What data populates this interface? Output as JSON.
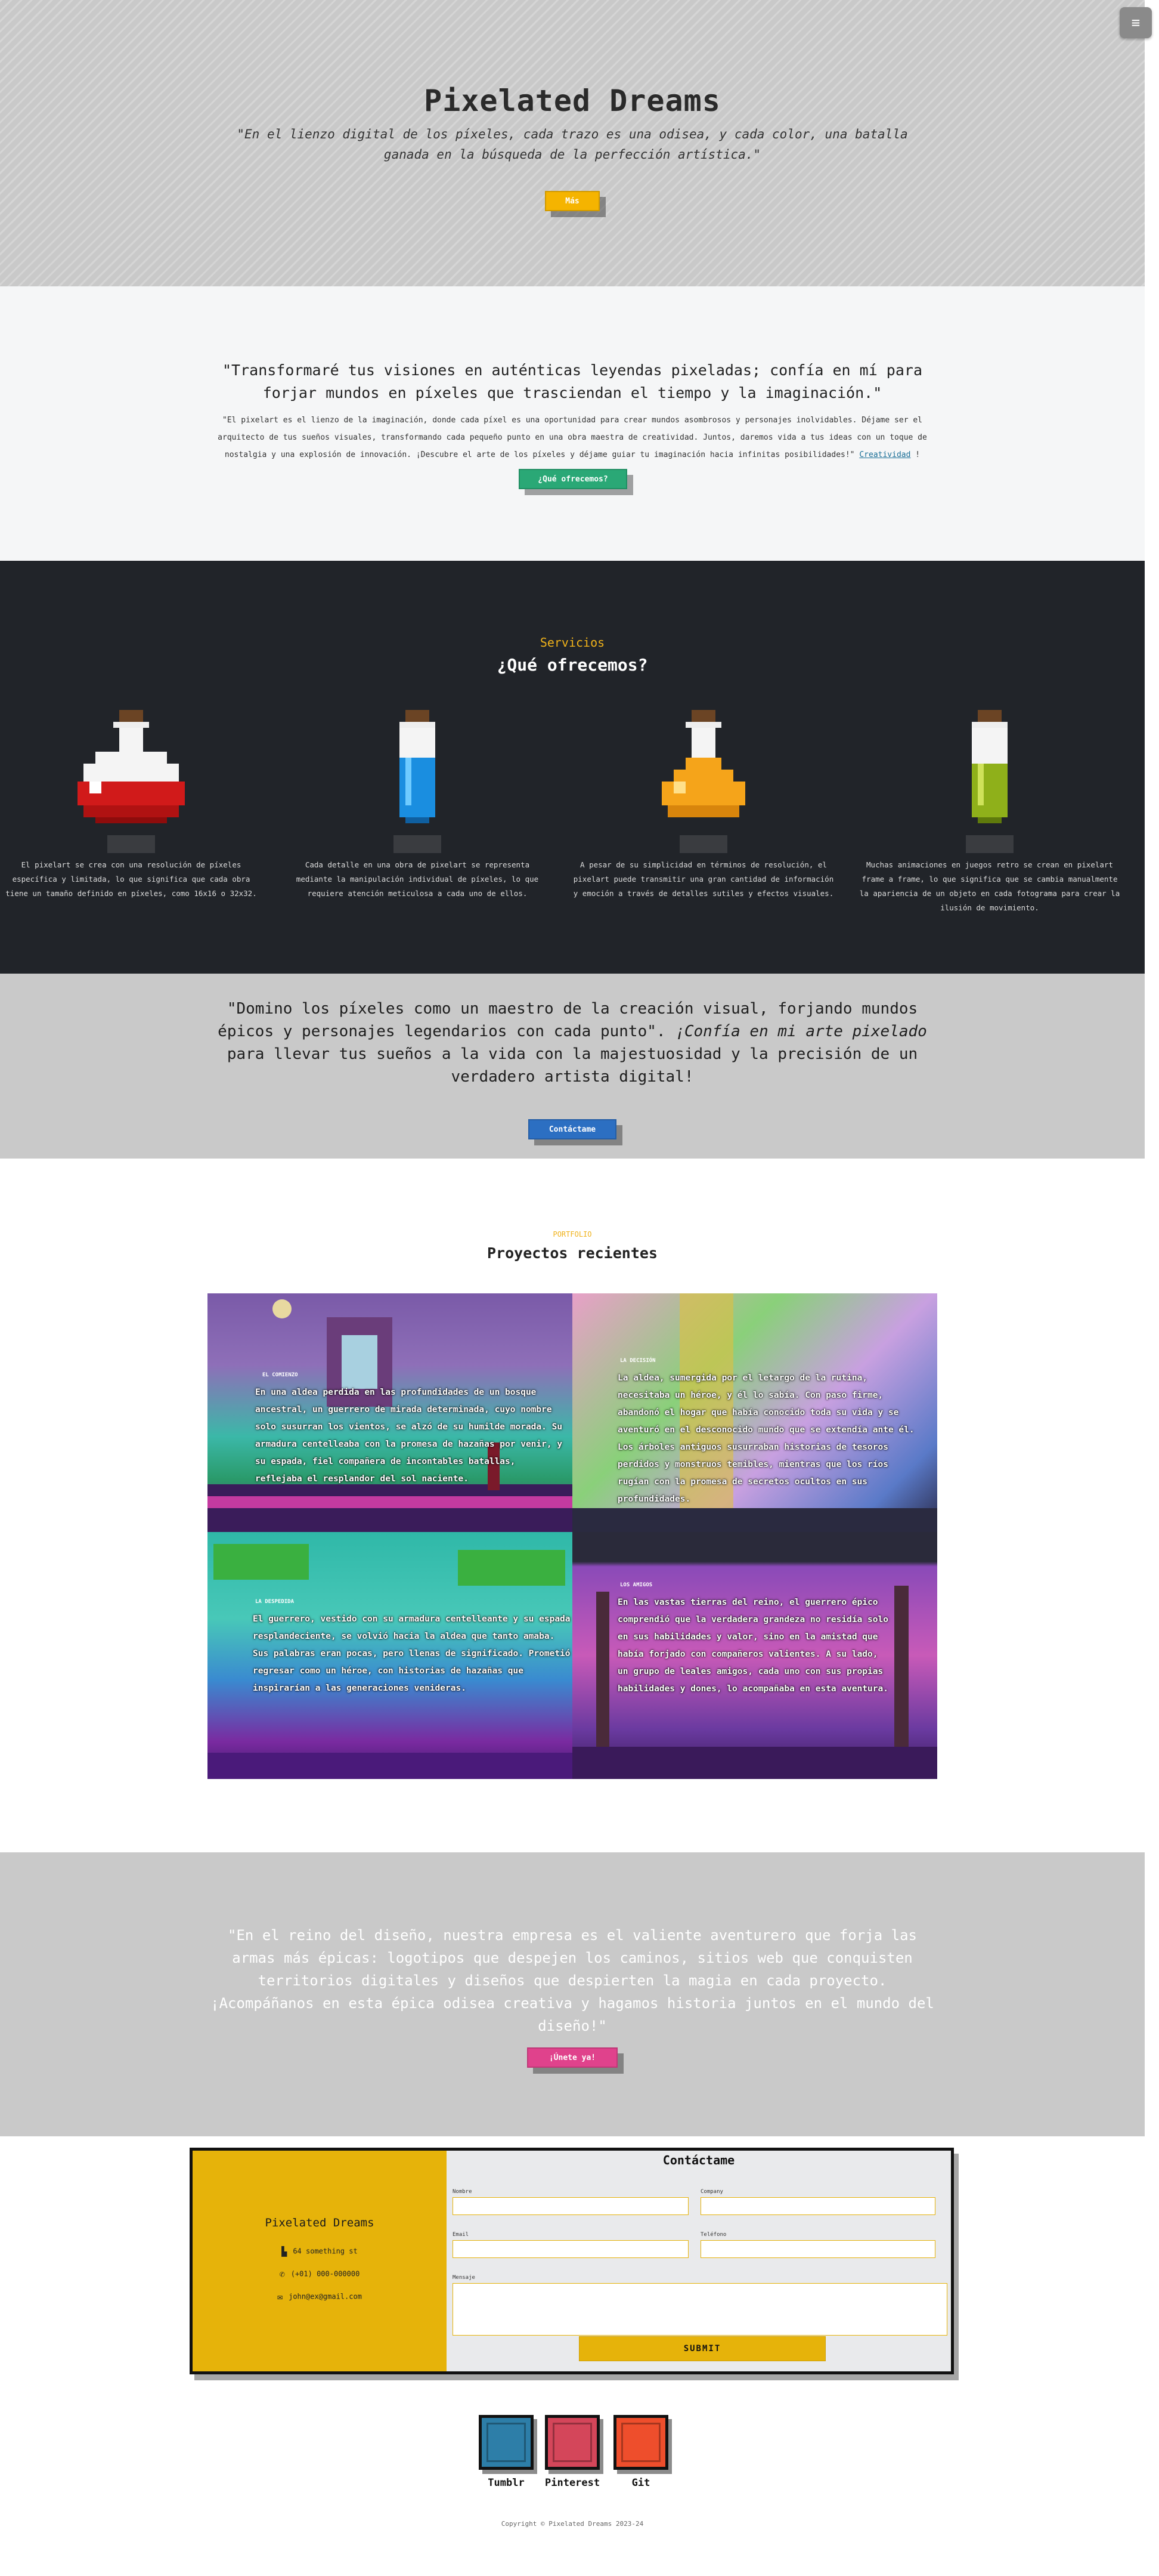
{
  "menu": {
    "icon": "hamburger-menu-icon",
    "glyph": "≡"
  },
  "hero": {
    "title": "Pixelated Dreams",
    "quote": "\"En el lienzo digital de los píxeles, cada trazo es una odisea, y cada color, una batalla ganada en la búsqueda de la perfección artística.\"",
    "button": "Más",
    "button_color": "#f5b400"
  },
  "intro": {
    "quote": "\"Transformaré tus visiones en auténticas leyendas pixeladas; confía en mí para forjar mundos en píxeles que trasciendan el tiempo y la imaginación.\"",
    "paragraph": "\"El pixelart es el lienzo de la imaginación, donde cada píxel es una oportunidad para crear mundos asombrosos y personajes inolvidables. Déjame ser el arquitecto de tus sueños visuales, transformando cada pequeño punto en una obra maestra de creatividad. Juntos, daremos vida a tus ideas con un toque de nostalgia y una explosión de innovación. ¡Descubre el arte de los píxeles y déjame guiar tu imaginación hacia infinitas posibilidades!\"",
    "link": "Creatividad",
    "suffix": " !",
    "button": "¿Qué ofrecemos?",
    "button_color": "#2aa876"
  },
  "services": {
    "kicker": "Servicios",
    "title": "¿Qué ofrecemos?",
    "items": [
      {
        "icon": "red-round-potion-icon",
        "color": "#d11a1a",
        "text": "El pixelart se crea con una resolución de píxeles específica y limitada, lo que significa que cada obra tiene un tamaño definido en píxeles, como 16x16 o 32x32."
      },
      {
        "icon": "blue-tube-potion-icon",
        "color": "#1a8ee0",
        "text": "Cada detalle en una obra de pixelart se representa mediante la manipulación individual de píxeles, lo que requiere atención meticulosa a cada uno de ellos."
      },
      {
        "icon": "orange-flask-potion-icon",
        "color": "#f5a41a",
        "text": "A pesar de su simplicidad en términos de resolución, el pixelart puede transmitir una gran cantidad de información y emoción a través de detalles sutiles y efectos visuales."
      },
      {
        "icon": "green-tube-potion-icon",
        "color": "#8fb01a",
        "text": "Muchas animaciones en juegos retro se crean en pixelart frame a frame, lo que significa que se cambia manualmente la apariencia de un objeto en cada fotograma para crear la ilusión de movimiento."
      }
    ]
  },
  "statement": {
    "quote_start": "\"Domino los píxeles como un maestro de la creación visual, forjando mundos épicos y personajes legendarios con cada punto\". ",
    "quote_em": "¡Confía en mi arte pixelado",
    "quote_end": " para llevar tus sueños a la vida con la majestuosidad y la precisión de un verdadero artista digital!",
    "button": "Contáctame",
    "button_color": "#2c6fc2"
  },
  "portfolio": {
    "kicker": "PORTFOLIO",
    "title": "Proyectos recientes",
    "tiles": [
      {
        "kicker": "EL COMIENZO",
        "text": "En una aldea perdida en las profundidades de un bosque ancestral, un guerrero de mirada determinada, cuyo nombre solo susurran los vientos, se alzó de su humilde morada. Su armadura centelleaba con la promesa de hazañas por venir, y su espada, fiel compañera de incontables batallas, reflejaba el resplandor del sol naciente."
      },
      {
        "kicker": "LA DECISIÓN",
        "text": "La aldea, sumergida por el letargo de la rutina, necesitaba un héroe, y él lo sabía. Con paso firme, abandonó el hogar que había conocido toda su vida y se aventuró en el desconocido mundo que se extendía ante él. Los árboles antiguos susurraban historias de tesoros perdidos y monstruos temibles, mientras que los ríos rugían con la promesa de secretos ocultos en sus profundidades."
      },
      {
        "kicker": "LA DESPEDIDA",
        "text": "El guerrero, vestido con su armadura centelleante y su espada resplandeciente, se volvió hacia la aldea que tanto amaba. Sus palabras eran pocas, pero llenas de significado. Prometió regresar como un héroe, con historias de hazañas que inspirarían a las generaciones venideras."
      },
      {
        "kicker": "LOS AMIGOS",
        "text": "En las vastas tierras del reino, el guerrero épico comprendió que la verdadera grandeza no residía solo en sus habilidades y valor, sino en la amistad que había forjado con compañeros valientes. A su lado, un grupo de leales amigos, cada uno con sus propias habilidades y dones, lo acompañaba en esta aventura."
      }
    ]
  },
  "cta": {
    "quote": "\"En el reino del diseño, nuestra empresa es el valiente aventurero que forja las armas más épicas: logotipos que despejen los caminos, sitios web que conquisten territorios digitales y diseños que despierten la magia en cada proyecto. ¡Acompáñanos en esta épica odisea creativa y hagamos historia juntos en el mundo del diseño!\"",
    "button": "¡Únete ya!",
    "button_color": "#e0428c"
  },
  "contact": {
    "brand": "Pixelated Dreams",
    "address": "64 something st",
    "phone": "(+01) 000-000000",
    "email": "john@ex@gmail.com",
    "address_icon": "building-icon",
    "phone_icon": "phone-icon",
    "email_icon": "envelope-icon",
    "title": "Contáctame",
    "labels": {
      "name": "Nombre",
      "company": "Company",
      "email": "Email",
      "phone": "Teléfono",
      "message": "Mensaje"
    },
    "submit": "SUBMIT",
    "accent": "#e6b30a"
  },
  "social": [
    {
      "label": "Tumblr",
      "color": "#2d7ea8"
    },
    {
      "label": "Pinterest",
      "color": "#d4465a"
    },
    {
      "label": "Git",
      "color": "#ee4e2c"
    }
  ],
  "footer": {
    "copyright": "Copyright © Pixelated Dreams 2023-24"
  }
}
